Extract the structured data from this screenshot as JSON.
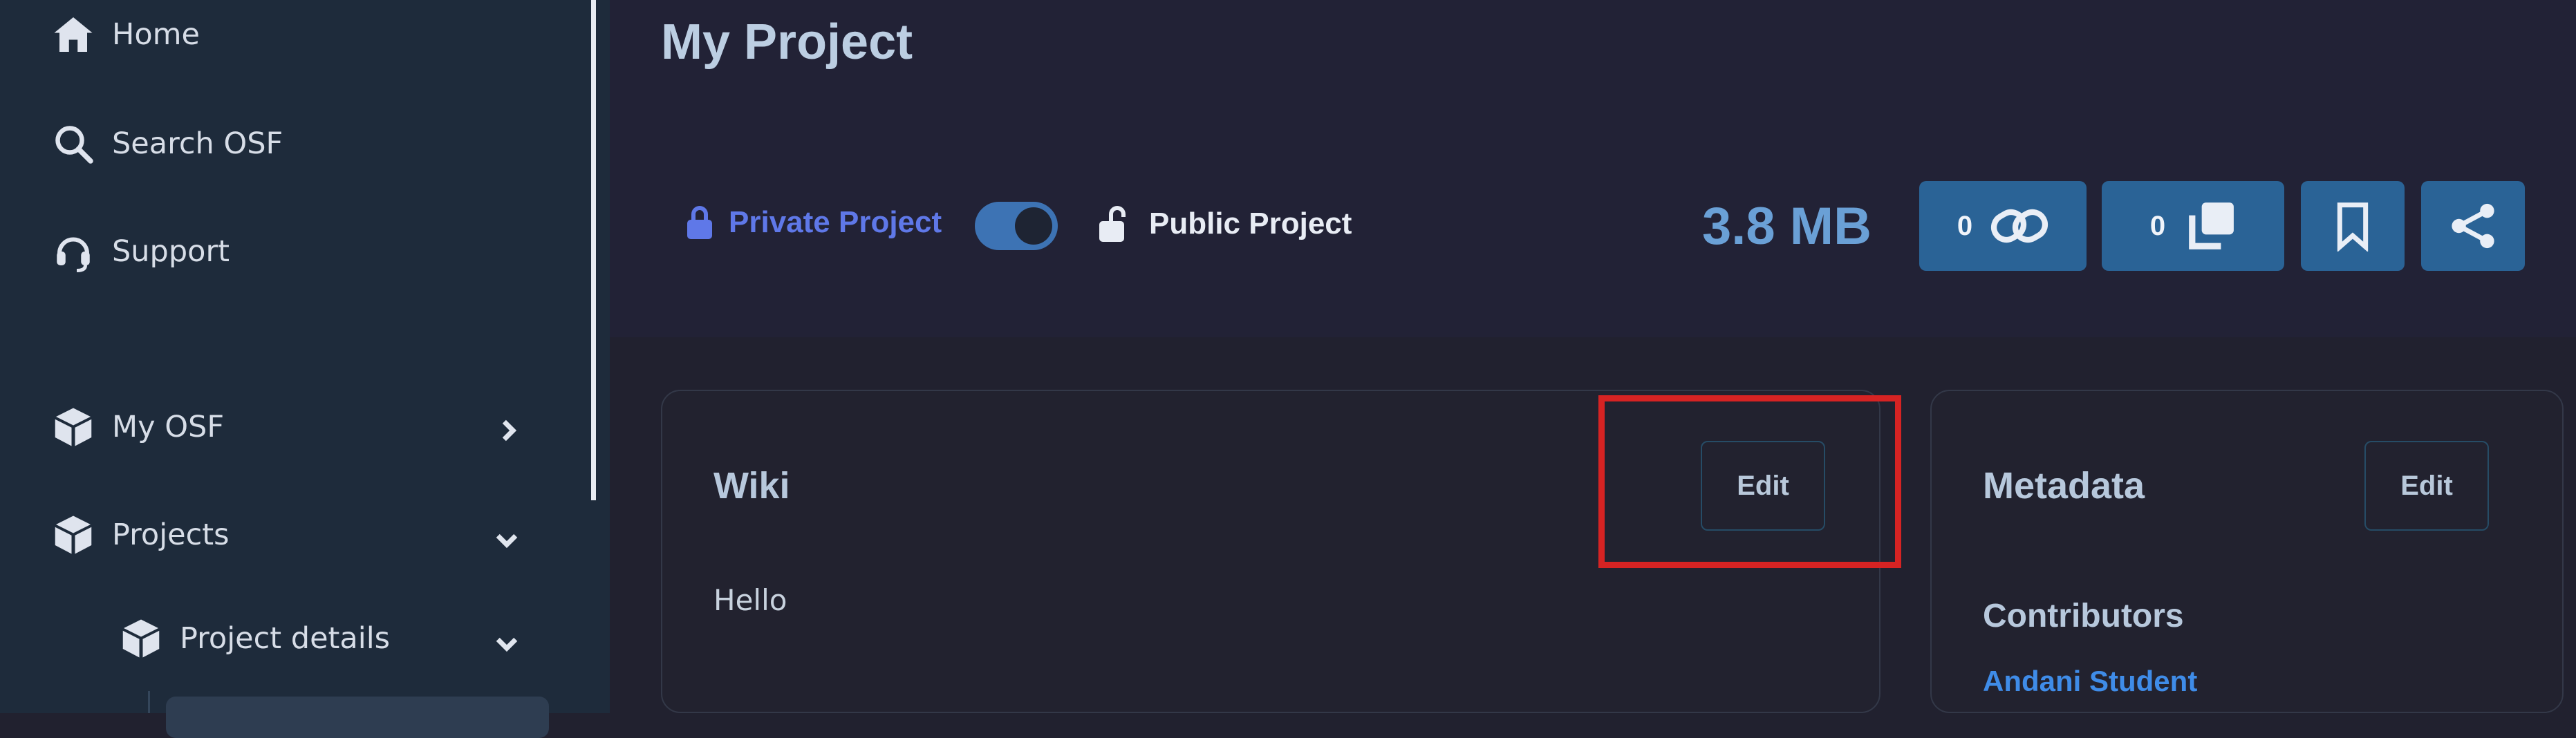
{
  "sidebar": {
    "items": [
      {
        "label": "Home",
        "icon": "home-icon"
      },
      {
        "label": "Search OSF",
        "icon": "search-icon"
      },
      {
        "label": "Support",
        "icon": "headset-icon"
      },
      {
        "label": "My OSF",
        "icon": "cube-icon"
      },
      {
        "label": "Projects",
        "icon": "cube-icon"
      },
      {
        "label": "Project details",
        "icon": "cube-icon"
      }
    ]
  },
  "header": {
    "title": "My Project",
    "private_label": "Private Project",
    "public_label": "Public Project",
    "storage_size": "3.8 MB",
    "link_count": "0",
    "fork_count": "0"
  },
  "wiki": {
    "title": "Wiki",
    "edit_label": "Edit",
    "content": "Hello"
  },
  "metadata": {
    "title": "Metadata",
    "edit_label": "Edit",
    "contributors_heading": "Contributors",
    "contributor_name": "Andani Student"
  },
  "colors": {
    "accent_blue": "#2a6396",
    "private_label": "#5f78e8",
    "highlight": "#d62323",
    "link": "#3f8ce8"
  }
}
